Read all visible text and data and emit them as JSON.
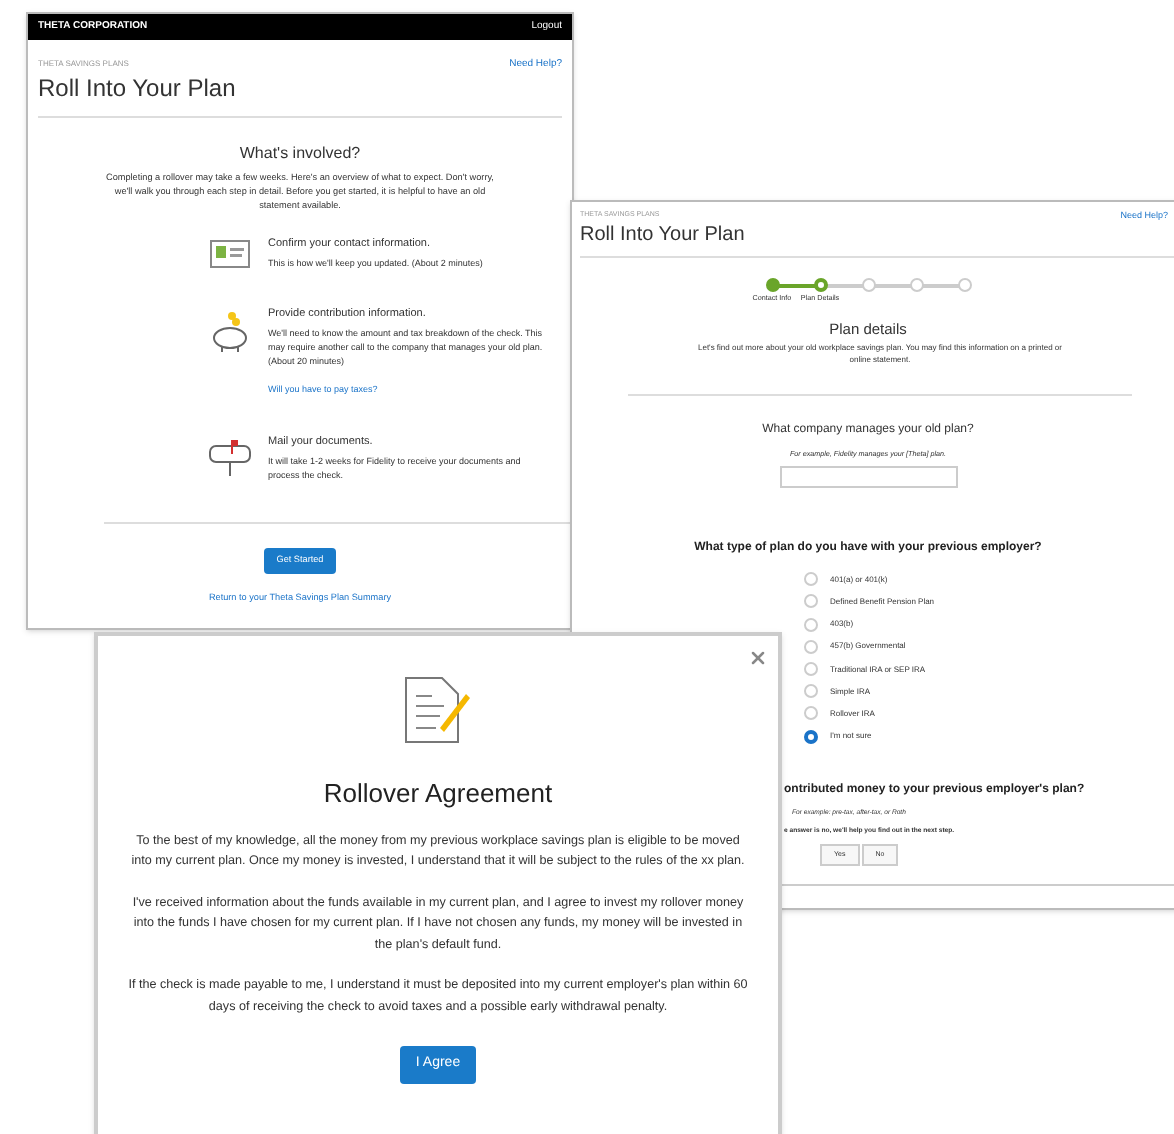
{
  "overview_window": {
    "brand": "THETA CORPORATION",
    "logout": "Logout",
    "section": "THETA SAVINGS PLANS",
    "help": "Need Help?",
    "title": "Roll Into Your Plan",
    "heading": "What's involved?",
    "intro": "Completing a rollover may take a few weeks. Here's an overview of what to expect. Don't worry, we'll walk you through each step in detail. Before you get started, it is helpful to have an old statement available.",
    "steps": [
      {
        "kind": "contact",
        "title": "Confirm your contact information.",
        "text": "This is how we'll keep you updated. (About 2 minutes)"
      },
      {
        "kind": "money",
        "title": "Provide contribution information.",
        "text": "We'll need to know the amount and tax breakdown of the check. This may require another call to the company that manages your old plan. (About 20 minutes)",
        "link": "Will you have to pay taxes?"
      },
      {
        "kind": "mail",
        "title": "Mail your documents.",
        "text": "It will take 1-2 weeks for Fidelity to receive your documents and process the check."
      }
    ],
    "button": "Get Started",
    "footer_link": "Return to your Theta Savings Plan Summary"
  },
  "plan_window": {
    "section": "THETA SAVINGS PLANS",
    "help": "Need Help?",
    "title": "Roll Into Your Plan",
    "progress": [
      {
        "label": "Contact Info",
        "completed": true,
        "selected": false
      },
      {
        "label": "Plan Details",
        "completed": false,
        "selected": true
      },
      {
        "completed": false,
        "selected": false
      },
      {
        "completed": false,
        "selected": false
      },
      {
        "completed": false,
        "selected": false
      }
    ],
    "heading": "Plan details",
    "intro": "Let's find out more about your old workplace savings plan. You may find this information on a printed or online statement.",
    "company_question": "What company manages your old plan?",
    "company_hint": "For example, Fidelity manages your [Theta] plan.",
    "type_question": "What type of plan do you have with your previous employer?",
    "plan_types": [
      {
        "label": "401(a) or 401(k)",
        "selected": false
      },
      {
        "label": "Defined Benefit Pension Plan",
        "selected": false
      },
      {
        "label": "403(b)",
        "selected": false
      },
      {
        "label": "457(b) Governmental",
        "selected": false
      },
      {
        "label": "Traditional IRA or SEP IRA",
        "selected": false
      },
      {
        "label": "Simple IRA",
        "selected": false
      },
      {
        "label": "Rollover IRA",
        "selected": false
      },
      {
        "label": "I'm not sure",
        "selected": true
      }
    ],
    "money_question": "ontributed money to your previous employer's plan?",
    "money_hint": "For example: pre-tax, after-tax, or Roth",
    "money_note": "e answer is no, we'll help you find out in the next step.",
    "answers": [
      "Yes",
      "No"
    ]
  },
  "agreement_dialog": {
    "title": "Rollover Agreement",
    "paragraphs": [
      "To the best of my knowledge, all the money from my previous workplace savings plan is eligible to be moved into my current plan. Once my money is invested, I understand that it will be subject to the rules of the xx plan.",
      "I've received information about the funds available in my current plan, and I agree to invest my rollover money into the funds I have chosen for my current plan. If I have not chosen any funds, my money will be invested in the plan's default fund.",
      "If the check is made payable to me, I understand it must be deposited into my current employer's plan within 60 days of receiving the check to avoid taxes and a possible early withdrawal penalty."
    ],
    "button": "I Agree"
  }
}
